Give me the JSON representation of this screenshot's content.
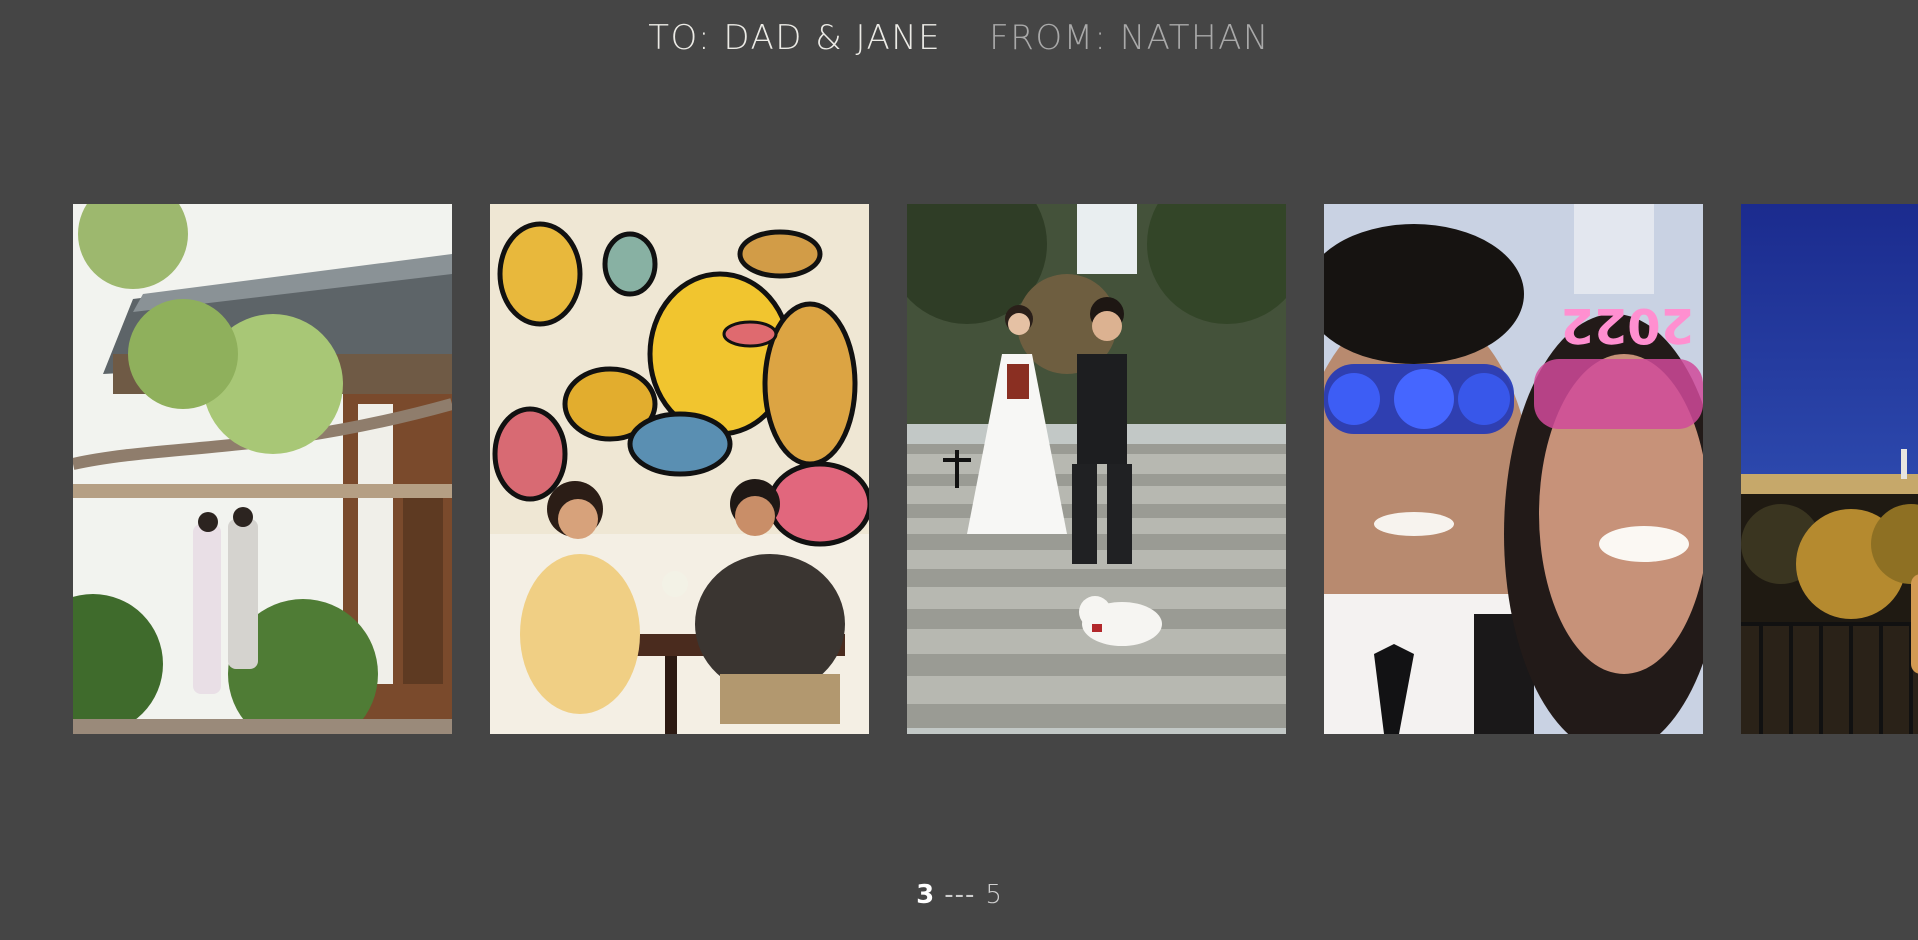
{
  "header": {
    "to_text": "TO: DAD & JANE",
    "from_text": "FROM: NATHAN"
  },
  "gallery": {
    "photos": [
      {
        "description_icon": "hanok-couple-photo"
      },
      {
        "description_icon": "cafe-mural-photo"
      },
      {
        "description_icon": "wedding-stairs-photo"
      },
      {
        "description_icon": "new-year-selfie-photo"
      },
      {
        "description_icon": "night-city-photo"
      }
    ]
  },
  "pager": {
    "current": "3",
    "separator": "---",
    "total": "5"
  },
  "colors": {
    "background": "#454545",
    "header_to": "#ecebe6",
    "header_from": "#a9a9a9"
  }
}
